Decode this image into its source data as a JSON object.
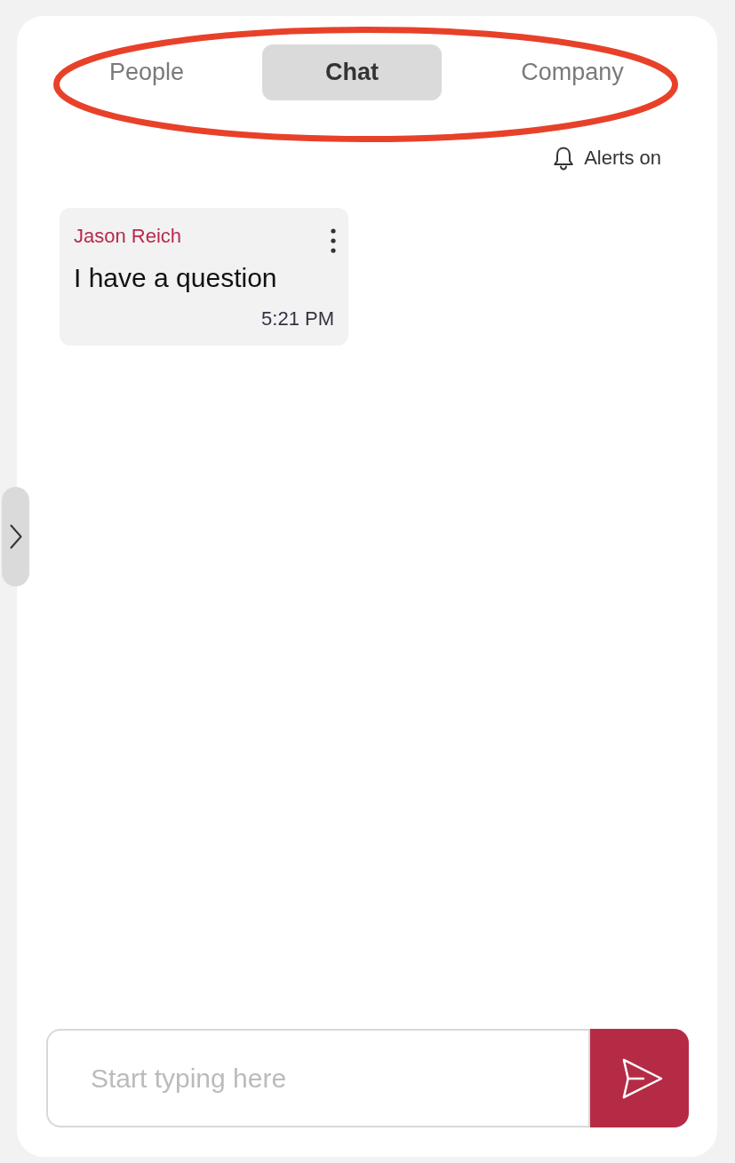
{
  "tabs": [
    {
      "label": "People",
      "selected": false
    },
    {
      "label": "Chat",
      "selected": true
    },
    {
      "label": "Company",
      "selected": false
    }
  ],
  "alerts": {
    "label": "Alerts on"
  },
  "messages": [
    {
      "sender": "Jason Reich",
      "text": "I have a question",
      "time": "5:21 PM"
    }
  ],
  "composer": {
    "placeholder": "Start typing here"
  }
}
